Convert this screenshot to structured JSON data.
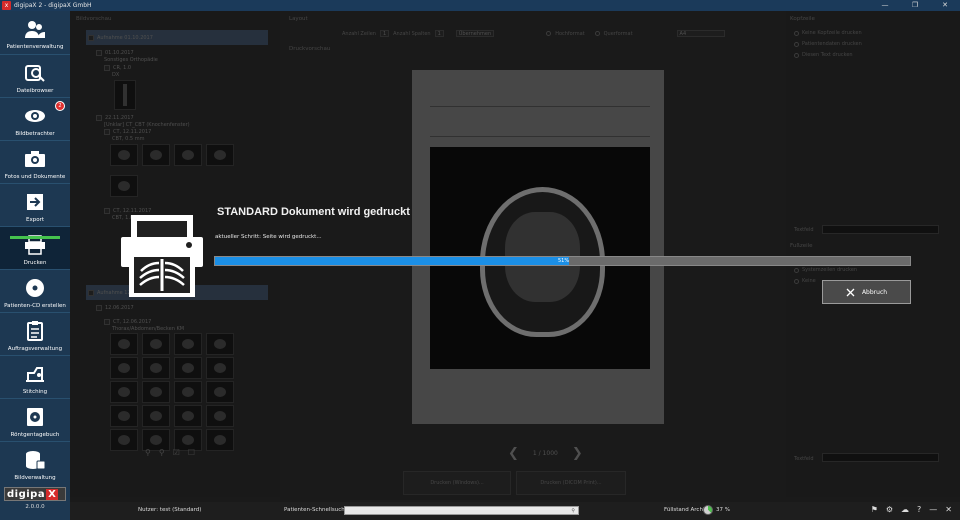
{
  "window": {
    "title": "digipaX 2 - digipaX GmbH",
    "controls": [
      "minimize",
      "restore",
      "close"
    ]
  },
  "sidebar": {
    "items": [
      {
        "label": "Patientenverwaltung",
        "icon": "patients-icon"
      },
      {
        "label": "Dateibrowser",
        "icon": "file-browser-icon"
      },
      {
        "label": "Bildbetrachter",
        "icon": "eye-icon",
        "badge": "2"
      },
      {
        "label": "Fotos und Dokumente",
        "icon": "camera-icon"
      },
      {
        "label": "Export",
        "icon": "export-icon"
      },
      {
        "label": "Drucken",
        "icon": "printer-icon",
        "active": true,
        "progress": 1.0
      },
      {
        "label": "Patienten-CD erstellen",
        "icon": "cd-icon"
      },
      {
        "label": "Auftragsverwaltung",
        "icon": "clipboard-icon"
      },
      {
        "label": "Stitching",
        "icon": "stitching-icon"
      },
      {
        "label": "Röntgentagebuch",
        "icon": "radiation-icon"
      },
      {
        "label": "Bildverwaltung",
        "icon": "database-icon"
      }
    ],
    "brand": {
      "text": "digipa",
      "x": "X",
      "version": "2.0.0.0"
    }
  },
  "left_panel": {
    "header": "Bildvorschau",
    "rows": [
      {
        "label": "Aufnahme 01.10.2017"
      },
      {
        "label": "01.10.2017"
      },
      {
        "label": "Sonstiges Orthopädie"
      },
      {
        "label": "CR, 1.0"
      },
      {
        "label": "DX"
      },
      {
        "label": "22.11.2017"
      },
      {
        "label": "[Unklar] CT_CBT (Knochenfenster)"
      },
      {
        "label": "CT, 12.11.2017"
      },
      {
        "label": "CBT, 0.5 mm"
      },
      {
        "label": "CT, 12.11.2017"
      },
      {
        "label": "CBT, 1.0 mm"
      },
      {
        "label": "Aufnahme 12.06.2017"
      },
      {
        "label": "12.06.2017"
      },
      {
        "label": "CT, 12.06.2017"
      },
      {
        "label": "Thorax/Abdomen/Becken KM"
      }
    ]
  },
  "center_panel": {
    "header": "Layout",
    "preview_label": "Druckvorschau",
    "rows_label": "Anzahl Zeilen",
    "rows_value": "1",
    "cols_label": "Anzahl Spalten",
    "cols_value": "1",
    "apply_label": "Übernehmen",
    "orientation_portrait": "Hochformat",
    "orientation_landscape": "Querformat",
    "paper_size": "A4",
    "page_indicator": "1 / 1000",
    "btn_print_windows": "Drucken (Windows)...",
    "btn_print_dicom": "Drucken (DICOM Print)..."
  },
  "right_panel": {
    "header": "Kopfzeile",
    "header_options": [
      "Keine Kopfzeile drucken",
      "Patientendaten drucken",
      "Diesen Text drucken"
    ],
    "text_label": "Textfeld",
    "footer_header": "Fußzeile",
    "footer_options": [
      "Systemzeilen drucken",
      "Keine"
    ],
    "footer_text_label": "Textfeld"
  },
  "dialog": {
    "title": "STANDARD Dokument wird gedruckt",
    "step": "aktueller Schritt: Seite wird gedruckt...",
    "progress_percent": 51,
    "progress_label": "51%",
    "abort_label": "Abbruch"
  },
  "statusbar": {
    "user": "Nutzer: test (Standard)",
    "search_label": "Patienten-Schnellsuche:",
    "search_value": "",
    "archive_label": "Füllstand Archiv:",
    "archive_percent": 37,
    "archive_value": "37 %"
  }
}
